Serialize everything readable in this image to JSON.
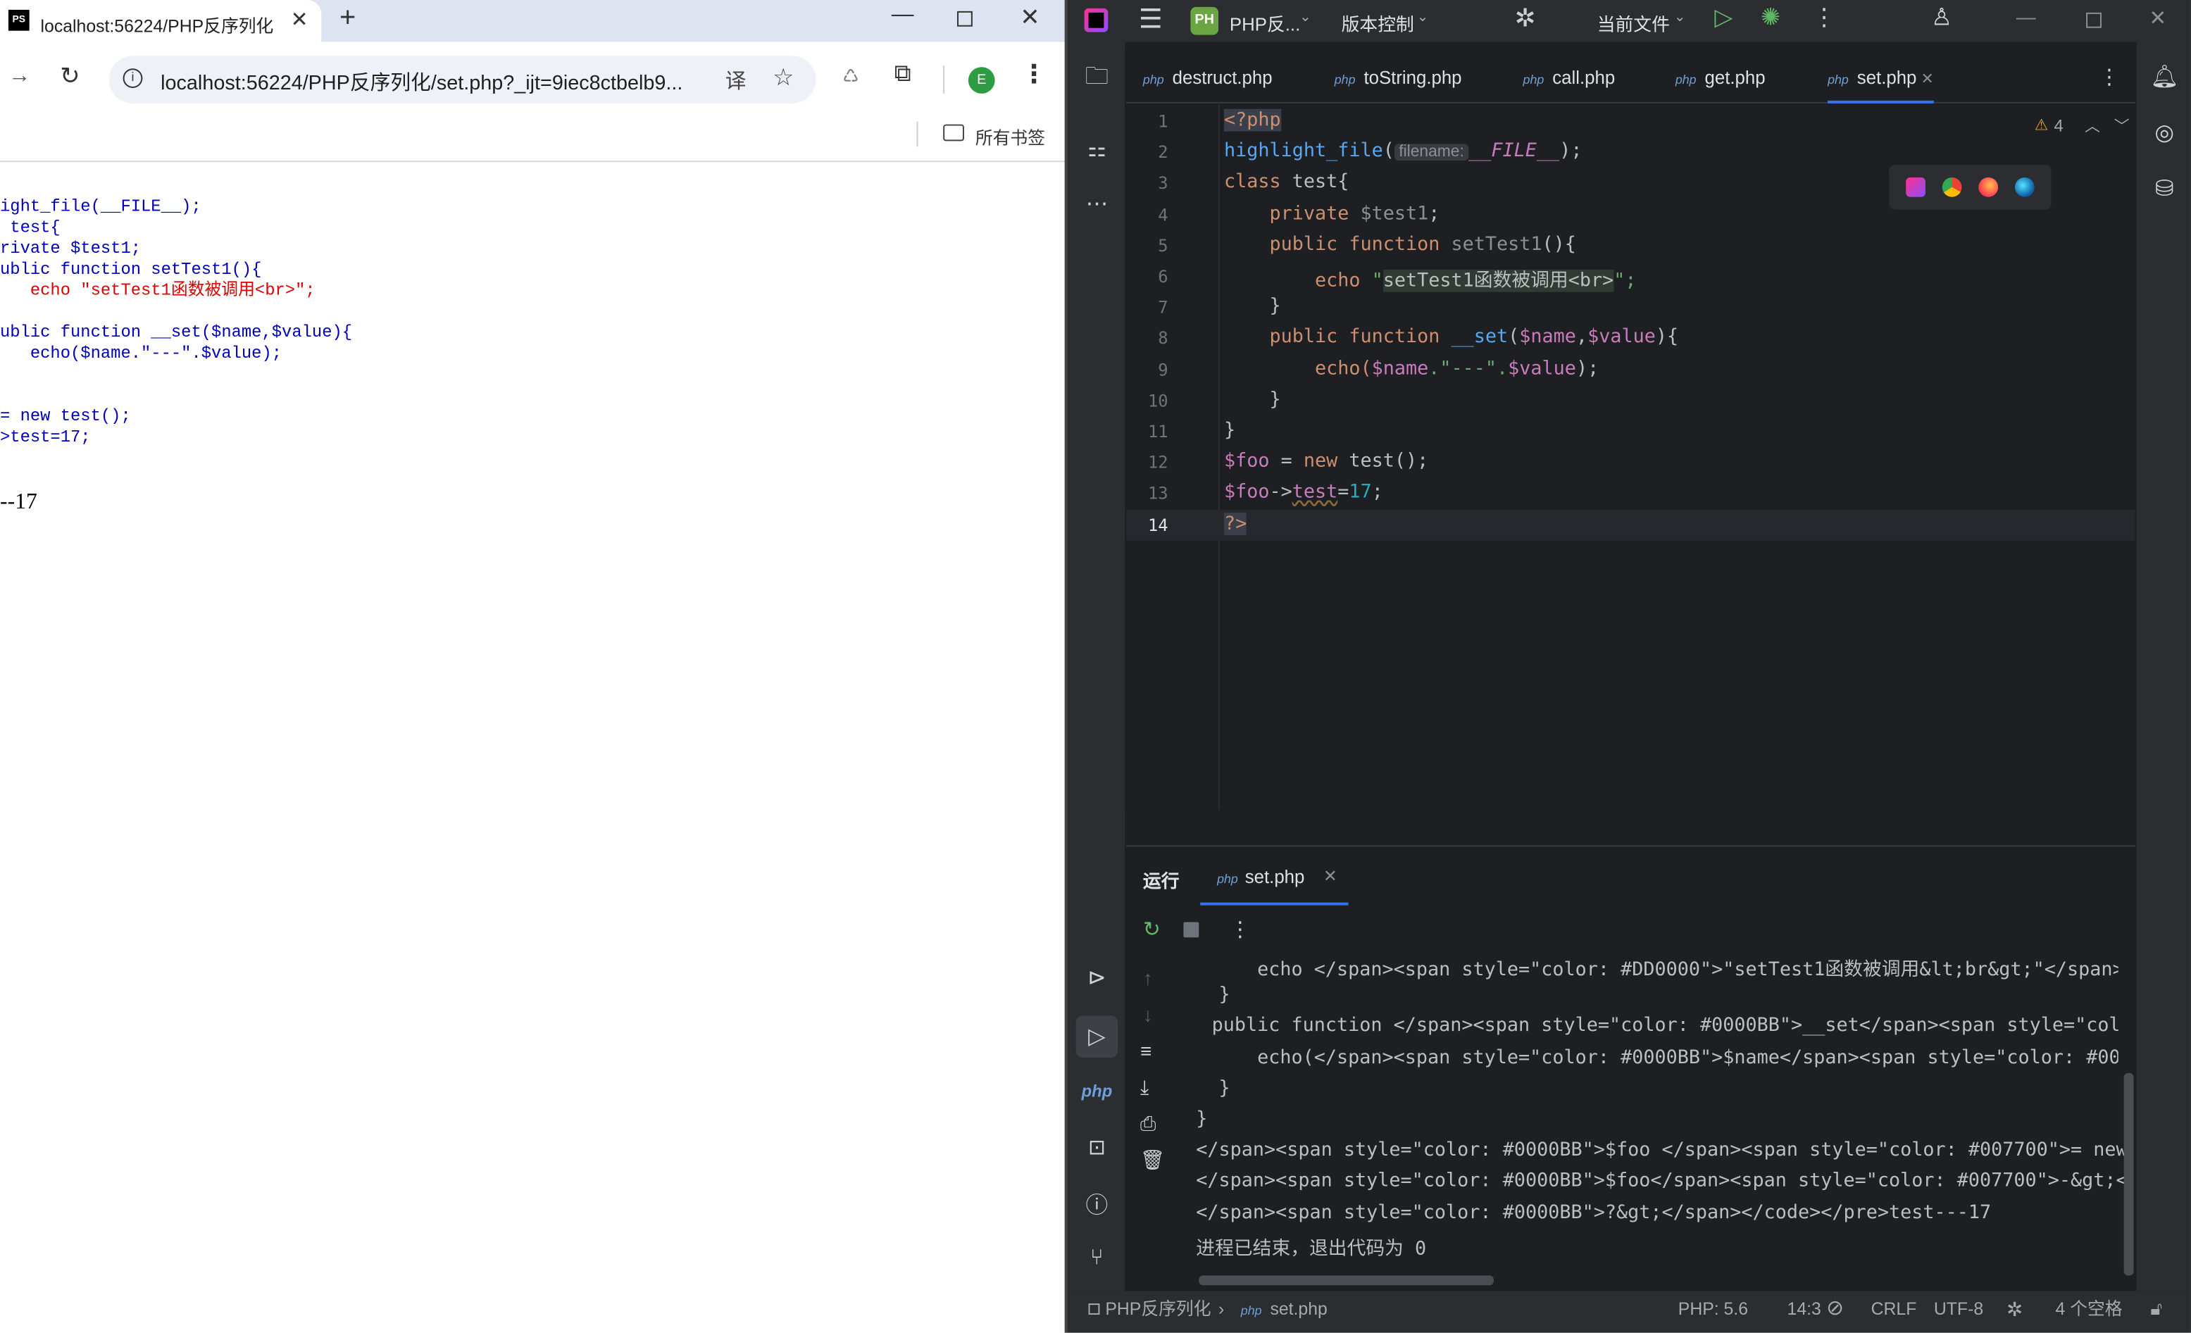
{
  "browser": {
    "tab_title": "localhost:56224/PHP反序列化",
    "tab_favicon": "PS",
    "url": "localhost:56224/PHP反序列化/set.php?_ijt=9iec8ctbelb9...",
    "bookmarks_label": "所有书签",
    "profile_initial": "E",
    "page_code": [
      "ight_file(__FILE__);",
      " test{",
      "rivate $test1;",
      "ublic function setTest1(){",
      "   echo \"setTest1函数被调用<br>\";",
      "",
      "ublic function __set($name,$value){",
      "   echo($name.\"---\".$value);",
      "",
      "",
      "= new test();",
      ">test=17;"
    ],
    "page_output": "--17"
  },
  "ide": {
    "project_badge": "PH",
    "project_name": "PHP反...",
    "vcs_label": "版本控制",
    "run_config": "当前文件",
    "tabs": [
      {
        "label": "destruct.php"
      },
      {
        "label": "toString.php"
      },
      {
        "label": "call.php"
      },
      {
        "label": "get.php"
      },
      {
        "label": "set.php"
      }
    ],
    "warning_count": "4",
    "line_numbers": [
      "1",
      "2",
      "3",
      "4",
      "5",
      "6",
      "7",
      "8",
      "9",
      "10",
      "11",
      "12",
      "13",
      "14"
    ],
    "param_hint": "filename:",
    "run_label": "运行",
    "run_tab": "set.php",
    "output_lines": [
      "      echo </span><span style=\"color: #DD0000\">\"setTest1函数被调用&lt;br&gt;\"</span>",
      "  }",
      "  public function </span><span style=\"color: #0000BB\">__set</span><span style=\"color",
      "      echo(</span><span style=\"color: #0000BB\">$name</span><span style=\"color: #00",
      "  }",
      "}",
      "</span><span style=\"color: #0000BB\">$foo </span><span style=\"color: #007700\">= new",
      "</span><span style=\"color: #0000BB\">$foo</span><span style=\"color: #007700\">-&gt;</s",
      "</span><span style=\"color: #0000BB\">?&gt;</span></code></pre>test---17",
      "进程已结束，退出代码为 0"
    ],
    "status": {
      "project": "PHP反序列化",
      "file": "set.php",
      "php_version": "PHP: 5.6",
      "position": "14:3",
      "line_sep": "CRLF",
      "encoding": "UTF-8",
      "indent": "4 个空格"
    }
  },
  "colors": {
    "keyword": "#cf8e6d",
    "variable": "#c77dbb",
    "function": "#56a8f5",
    "string": "#6aab73",
    "number": "#2aacb8",
    "browser_keyword": "#007700",
    "browser_var": "#0000bb",
    "browser_string": "#dd0000"
  }
}
